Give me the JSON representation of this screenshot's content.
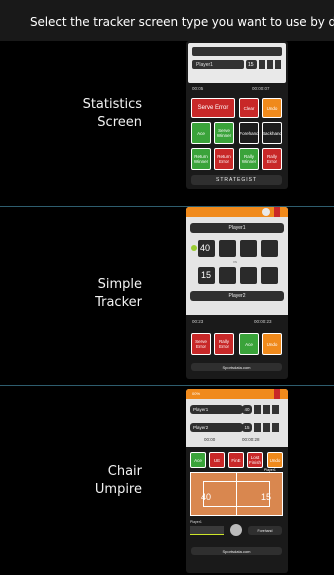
{
  "header": {
    "text": "Select the tracker screen type you want to use by default"
  },
  "rows": [
    {
      "label_line1": "Statistics",
      "label_line2": "Screen"
    },
    {
      "label_line1": "Simple",
      "label_line2": "Tracker"
    },
    {
      "label_line1": "Chair",
      "label_line2": "Umpire"
    }
  ],
  "stats_preview": {
    "player": "Player1",
    "score": "15",
    "time_left": "00:05",
    "time_right": "00:00:07",
    "serve_error": "Serve Error",
    "clear": "Clear",
    "undo": "Undo",
    "buttons_row1": [
      "Ace",
      "Serve Winner",
      "Forehand",
      "Backhand"
    ],
    "buttons_row2": [
      "Return Winner",
      "Return Error",
      "Rally Winner",
      "Rally Error"
    ],
    "brand": "STRATEGIST"
  },
  "simple_preview": {
    "player1": "Player1",
    "player2": "Player2",
    "score1": "40",
    "score2": "15",
    "vs": "vs",
    "time_left": "00:23",
    "time_right": "00:00:23",
    "buttons": [
      "Serve Error",
      "Rally Error",
      "Ace",
      "Undo"
    ],
    "footer": "Sportsdata.com"
  },
  "chair_preview": {
    "top_label": "00%",
    "player1": "Player1",
    "player2": "Player2",
    "score1": "40",
    "score2": "15",
    "time_left": "00:00",
    "time_right": "00:00:28",
    "buttons": [
      "Ace",
      "UE",
      "FinE",
      "Lost Finish",
      "Undo"
    ],
    "court_left": "40",
    "court_right": "15",
    "player_tag": "Player1",
    "bottom_label": "Player1",
    "bottom_right": "Forehand",
    "footer": "Sportsdata.com"
  },
  "colors": {
    "accent_orange": "#f08a1c",
    "red": "#c82828",
    "green": "#3aa33a",
    "court": "#d9874f",
    "divider": "#2e5d6e"
  }
}
